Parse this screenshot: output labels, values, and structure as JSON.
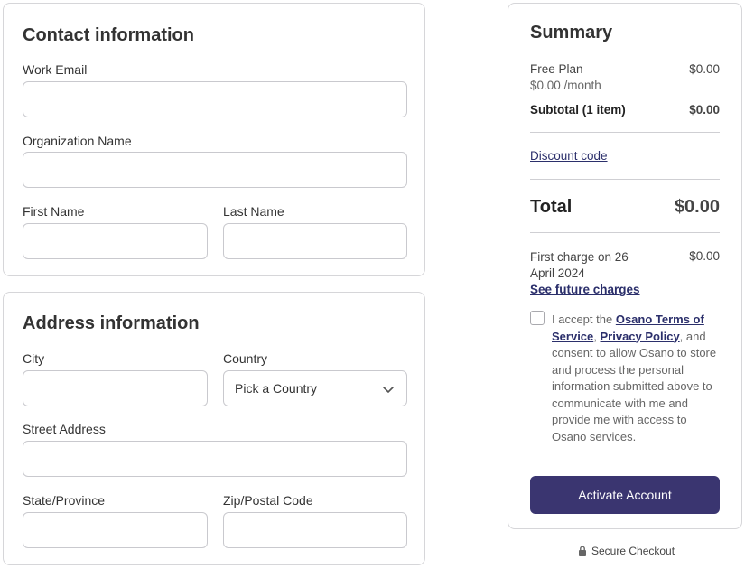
{
  "contact": {
    "title": "Contact information",
    "work_email_label": "Work Email",
    "org_name_label": "Organization Name",
    "first_name_label": "First Name",
    "last_name_label": "Last Name"
  },
  "address": {
    "title": "Address information",
    "city_label": "City",
    "country_label": "Country",
    "country_value": "Pick a Country",
    "street_label": "Street Address",
    "state_label": "State/Province",
    "zip_label": "Zip/Postal Code"
  },
  "summary": {
    "title": "Summary",
    "plan_name": "Free Plan",
    "plan_price": "$0.00",
    "plan_rate": "$0.00 /month",
    "subtotal_label": "Subtotal (1 item)",
    "subtotal_value": "$0.00",
    "discount_link": "Discount code",
    "total_label": "Total",
    "total_value": "$0.00",
    "first_charge_label": "First charge on 26 April 2024",
    "first_charge_value": "$0.00",
    "future_charges_link": "See future charges",
    "terms_prefix": "I accept the ",
    "terms_link": "Osano Terms of Service",
    "terms_sep": ", ",
    "privacy_link": "Privacy Policy",
    "terms_suffix": ", and consent to allow Osano to store and process the personal information submitted above to communicate with me and provide me with access to Osano services.",
    "activate_button": "Activate Account"
  },
  "footer": {
    "secure_checkout": "Secure Checkout"
  },
  "icons": {
    "chevron": "chevron-down-icon",
    "lock": "lock-icon"
  },
  "colors": {
    "accent": "#3a3570",
    "link": "#2b2f6b"
  }
}
